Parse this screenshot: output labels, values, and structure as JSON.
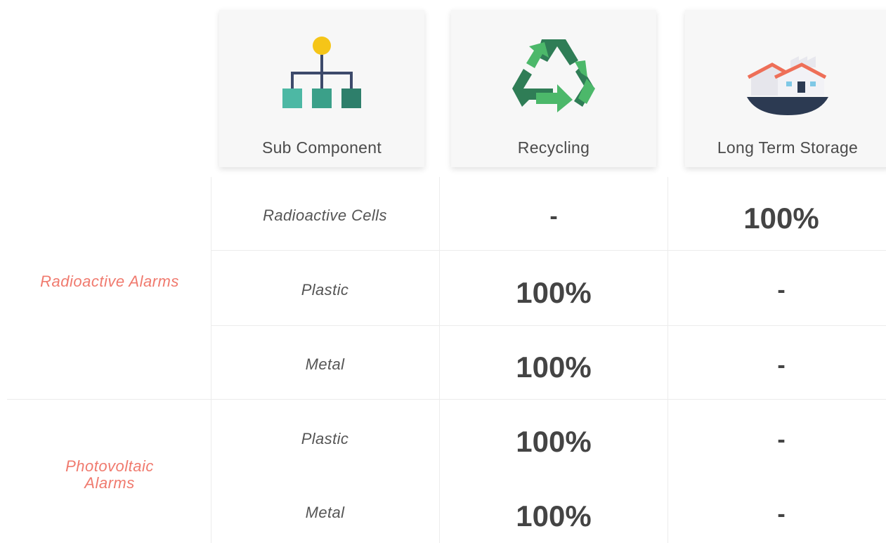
{
  "columns": {
    "sub_component": {
      "label": "Sub Component",
      "icon": "hierarchy-icon"
    },
    "recycling": {
      "label": "Recycling",
      "icon": "recycle-icon"
    },
    "long_term_storage": {
      "label": "Long Term Storage",
      "icon": "storage-facility-icon"
    }
  },
  "groups": [
    {
      "label": "Radioactive Alarms"
    },
    {
      "label": "Photovoltaic Alarms"
    }
  ],
  "rows": [
    {
      "sub": "Radioactive Cells",
      "recycling": "-",
      "storage": "100%"
    },
    {
      "sub": "Plastic",
      "recycling": "100%",
      "storage": "-"
    },
    {
      "sub": "Metal",
      "recycling": "100%",
      "storage": "-"
    },
    {
      "sub": "Plastic",
      "recycling": "100%",
      "storage": "-"
    },
    {
      "sub": "Metal",
      "recycling": "100%",
      "storage": "-"
    }
  ],
  "colors": {
    "accent_label": "#f07a6e",
    "recycle_light": "#4cb86a",
    "recycle_dark": "#2f7d56",
    "hierarchy_node": "#f5c518"
  }
}
